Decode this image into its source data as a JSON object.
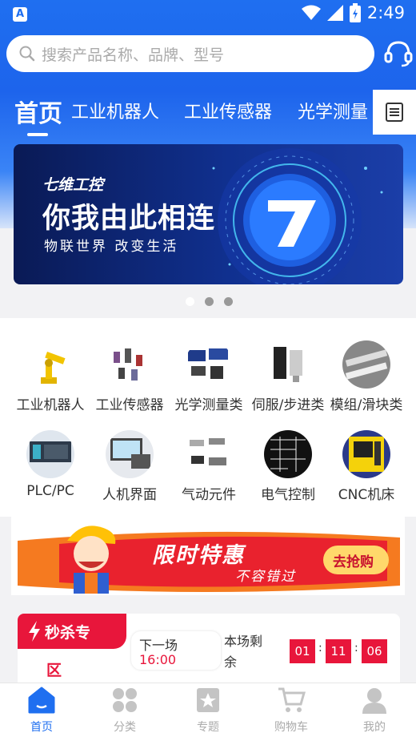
{
  "status_bar": {
    "time": "2:49"
  },
  "search": {
    "placeholder": "搜索产品名称、品牌、型号"
  },
  "tabs": [
    {
      "label": "首页",
      "active": true
    },
    {
      "label": "工业机器人"
    },
    {
      "label": "工业传感器"
    },
    {
      "label": "光学测量"
    }
  ],
  "banner": {
    "brand": "七维工控",
    "slogan": "你我由此相连",
    "subtitle": "物联世界 改变生活",
    "dots": 3,
    "active_dot": 0
  },
  "categories": [
    {
      "label": "工业机器人",
      "icon": "robot-arm-icon"
    },
    {
      "label": "工业传感器",
      "icon": "sensor-icon"
    },
    {
      "label": "光学测量类",
      "icon": "optical-measure-icon"
    },
    {
      "label": "伺服/步进类",
      "icon": "servo-motor-icon"
    },
    {
      "label": "模组/滑块类",
      "icon": "slide-module-icon"
    },
    {
      "label": "PLC/PC",
      "icon": "plc-icon"
    },
    {
      "label": "人机界面",
      "icon": "hmi-icon"
    },
    {
      "label": "气动元件",
      "icon": "pneumatic-icon"
    },
    {
      "label": "电气控制",
      "icon": "electric-control-icon"
    },
    {
      "label": "CNC机床",
      "icon": "cnc-icon"
    }
  ],
  "promo": {
    "title": "限时特惠",
    "subtitle": "不容错过",
    "button": "去抢购"
  },
  "flash_sale": {
    "tag_line1": "秒杀专",
    "tag_line2": "区",
    "next_label": "下一场",
    "next_time": "16:00",
    "remain_line1": "本场剩",
    "remain_line2": "余",
    "hours": "01",
    "minutes": "11",
    "seconds": "06",
    "colon": ":"
  },
  "bottom_nav": [
    {
      "label": "首页",
      "icon": "home-icon",
      "active": true
    },
    {
      "label": "分类",
      "icon": "category-icon"
    },
    {
      "label": "专题",
      "icon": "topic-icon"
    },
    {
      "label": "购物车",
      "icon": "cart-icon"
    },
    {
      "label": "我的",
      "icon": "profile-icon"
    }
  ],
  "colors": {
    "primary": "#1f6ff0",
    "sale_red": "#e8163b",
    "promo_orange": "#f57a20",
    "nav_inactive": "#bdbdbd"
  }
}
